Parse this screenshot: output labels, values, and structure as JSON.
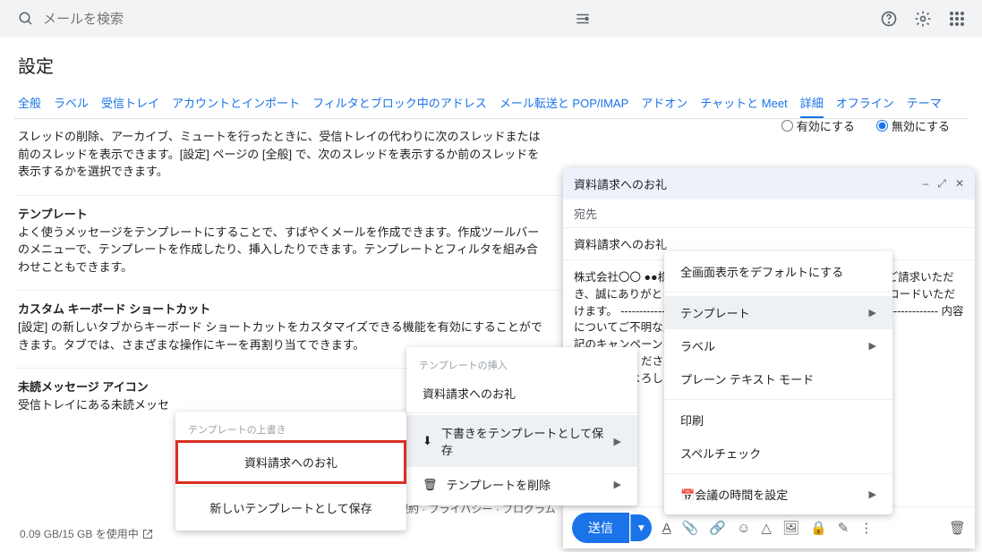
{
  "search": {
    "placeholder": "メールを検索"
  },
  "page_title": "設定",
  "tabs": [
    "全般",
    "ラベル",
    "受信トレイ",
    "アカウントとインポート",
    "フィルタとブロック中のアドレス",
    "メール転送と POP/IMAP",
    "アドオン",
    "チャットと Meet",
    "詳細",
    "オフライン",
    "テーマ"
  ],
  "active_tab": "詳細",
  "radio": {
    "enable": "有効にする",
    "disable": "無効にする"
  },
  "sections": {
    "autoadvance": "スレッドの削除、アーカイブ、ミュートを行ったときに、受信トレイの代わりに次のスレッドまたは前のスレッドを表示できます。[設定] ページの [全般] で、次のスレッドを表示するか前のスレッドを表示するかを選択できます。",
    "template_title": "テンプレート",
    "template_desc": "よく使うメッセージをテンプレートにすることで、すばやくメールを作成できます。作成ツールバーのメニューで、テンプレートを作成したり、挿入したりできます。テンプレートとフィルタを組み合わせこともできます。",
    "shortcut_title": "カスタム キーボード ショートカット",
    "shortcut_desc": "[設定] の新しいタブからキーボード ショートカットをカスタマイズできる機能を有効にすることができます。タブでは、さまざまな操作にキーを再割り当てできます。",
    "unread_title": "未読メッセージ アイコン",
    "unread_desc": "受信トレイにある未読メッセ"
  },
  "footer": {
    "storage": "0.09 GB/15 GB を使用中",
    "legal": "利用規約 · プライバシー · プログラム"
  },
  "compose": {
    "title": "資料請求へのお礼",
    "to_label": "宛先",
    "subject": "資料請求へのお礼",
    "body": "株式会社〇〇 ●●様 この度は■■（製品・サービス名）の資料をご請求いただき、誠にありがとうございます。 資料は以下のURLよりダウンロードいただけます。 ------------------------ http://************************ ------------------------ 内容についてご不明な点やご質問がございましたら、　　　　　　　　　　　　　　　　　　　　　　　　　　　　　　　記のキャンペーンを実施しており　　　　　　　　　　　　　　　　　　　　　　　　　　　　　　　　ぜひご一読ください。　　　　　　　　　　　　　　　　　　　　　　　　　　　　　　　　　　　　　後とも何卒よろし",
    "send": "送信"
  },
  "ctx": {
    "fullscreen": "全画面表示をデフォルトにする",
    "template": "テンプレート",
    "label": "ラベル",
    "plaintext": "プレーン テキスト モード",
    "print": "印刷",
    "spell": "スペルチェック",
    "meeting": "会議の時間を設定"
  },
  "submenu": {
    "insert_hdr": "テンプレートの挿入",
    "item1": "資料請求へのお礼",
    "save_draft": "下書きをテンプレートとして保存",
    "delete": "テンプレートを削除"
  },
  "submenu2": {
    "hdr": "テンプレートの上書き",
    "overwrite": "資料請求へのお礼",
    "save_new": "新しいテンプレートとして保存"
  }
}
